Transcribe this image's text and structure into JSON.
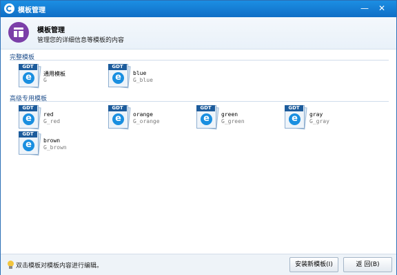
{
  "window": {
    "title": "模板管理",
    "minimize_glyph": "—",
    "close_glyph": "✕"
  },
  "header": {
    "title": "模板管理",
    "subtitle": "管理您的详细信息等模板的内容",
    "icon": "template-layout-icon"
  },
  "sections": [
    {
      "label": "完整模板",
      "items": [
        {
          "name": "通用模板",
          "code": "G"
        },
        {
          "name": "blue",
          "code": "G_blue"
        }
      ]
    },
    {
      "label": "高级专用模板",
      "items": [
        {
          "name": "red",
          "code": "G_red"
        },
        {
          "name": "orange",
          "code": "G_orange"
        },
        {
          "name": "green",
          "code": "G_green"
        },
        {
          "name": "gray",
          "code": "G_gray"
        },
        {
          "name": "brown",
          "code": "G_brown"
        }
      ]
    }
  ],
  "template_icon": {
    "tag": "GDT",
    "glyph": "e"
  },
  "footer": {
    "hint": "双击模板对模板内容进行编辑。",
    "install_button": "安装新模板(I)",
    "back_button": "返 回(B)"
  },
  "colors": {
    "titlebar": "#1a7fd6",
    "accent_purple": "#7b3fa8",
    "section_label": "#1f4f8c"
  }
}
